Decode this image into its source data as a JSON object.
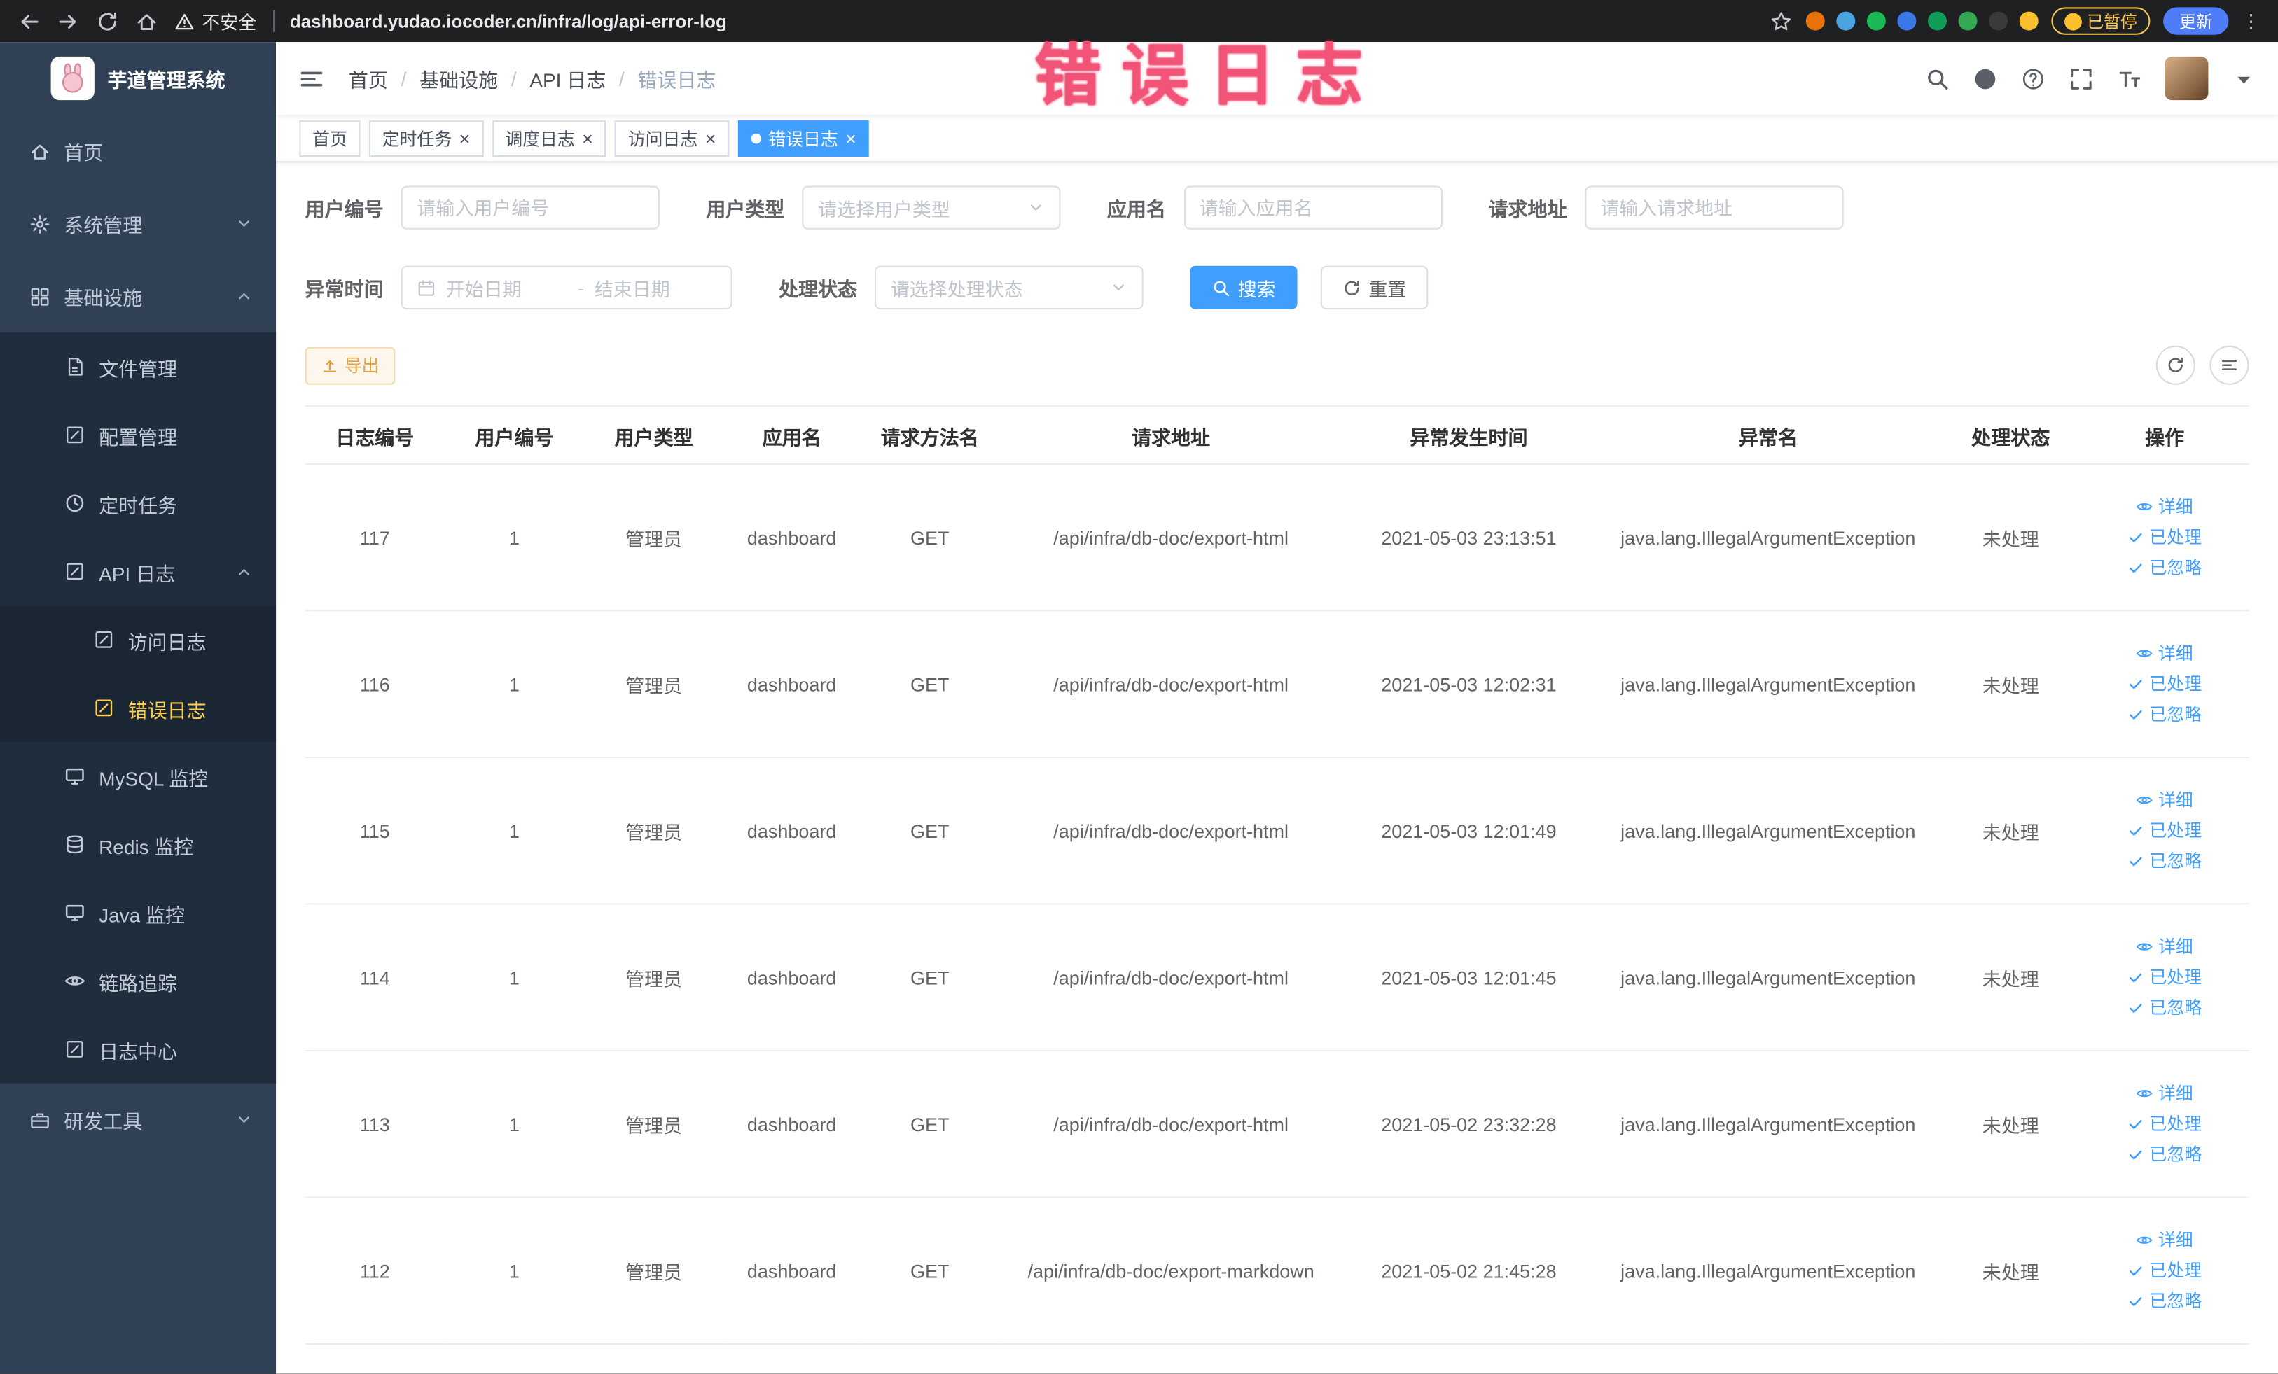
{
  "watermark": "错误日志",
  "colors": {
    "accent": "#409eff",
    "sidebar_active": "#ffd04b",
    "warning": "#e6a23c",
    "watermark_pink": "#f25477",
    "sidebar_bg": "#304156",
    "submenu_bg": "#1f2d3d"
  },
  "browser": {
    "security_label": "不安全",
    "url": "dashboard.yudao.iocoder.cn/infra/log/api-error-log",
    "paused_badge": "已暂停",
    "update_button": "更新",
    "extensions": [
      {
        "name": "extension-orange-icon",
        "color": "#e8710a"
      },
      {
        "name": "extension-blue-drop-icon",
        "color": "#4aa3df"
      },
      {
        "name": "extension-green-circle-icon",
        "color": "#1db954"
      },
      {
        "name": "extension-metro-grid-icon",
        "color": "#3b78e7"
      },
      {
        "name": "extension-on-badge-icon",
        "color": "#0f9d58"
      },
      {
        "name": "extension-leaf-icon",
        "color": "#34a853"
      },
      {
        "name": "extension-paw-icon",
        "color": "#3a3a3a"
      },
      {
        "name": "extension-smiley-icon",
        "color": "#fbc02d"
      }
    ]
  },
  "sidebar": {
    "logo_title": "芋道管理系统",
    "items": [
      {
        "name": "home",
        "label": "首页",
        "icon": "home-icon",
        "level": 1
      },
      {
        "name": "system-mgmt",
        "label": "系统管理",
        "icon": "gear-icon",
        "level": 1,
        "arrow": "down"
      },
      {
        "name": "infrastructure",
        "label": "基础设施",
        "icon": "grid-icon",
        "level": 1,
        "arrow": "up"
      },
      {
        "name": "file-mgmt",
        "label": "文件管理",
        "icon": "doc-icon",
        "level": 2
      },
      {
        "name": "config-mgmt",
        "label": "配置管理",
        "icon": "edit-icon",
        "level": 2
      },
      {
        "name": "scheduled-jobs",
        "label": "定时任务",
        "icon": "clock-icon",
        "level": 2
      },
      {
        "name": "api-logs",
        "label": "API 日志",
        "icon": "edit-icon",
        "level": 2,
        "arrow": "up"
      },
      {
        "name": "access-log",
        "label": "访问日志",
        "icon": "edit-icon",
        "level": 3
      },
      {
        "name": "error-log",
        "label": "错误日志",
        "icon": "edit-icon",
        "level": 3,
        "active": true
      },
      {
        "name": "mysql-monitor",
        "label": "MySQL 监控",
        "icon": "monitor-icon",
        "level": 2
      },
      {
        "name": "redis-monitor",
        "label": "Redis 监控",
        "icon": "db-icon",
        "level": 2
      },
      {
        "name": "java-monitor",
        "label": "Java 监控",
        "icon": "monitor-icon",
        "level": 2
      },
      {
        "name": "link-tracing",
        "label": "链路追踪",
        "icon": "eye-icon",
        "level": 2
      },
      {
        "name": "log-center",
        "label": "日志中心",
        "icon": "edit-icon",
        "level": 2
      },
      {
        "name": "dev-tools",
        "label": "研发工具",
        "icon": "toolbox-icon",
        "level": 1,
        "arrow": "down"
      }
    ]
  },
  "header": {
    "breadcrumb": [
      "首页",
      "基础设施",
      "API 日志",
      "错误日志"
    ]
  },
  "tabs": [
    {
      "name": "home",
      "label": "首页",
      "closable": false,
      "active": false
    },
    {
      "name": "scheduled-jobs",
      "label": "定时任务",
      "closable": true,
      "active": false
    },
    {
      "name": "dispatch-log",
      "label": "调度日志",
      "closable": true,
      "active": false
    },
    {
      "name": "access-log",
      "label": "访问日志",
      "closable": true,
      "active": false
    },
    {
      "name": "error-log",
      "label": "错误日志",
      "closable": true,
      "active": true
    }
  ],
  "filters": {
    "user_id": {
      "label": "用户编号",
      "placeholder": "请输入用户编号"
    },
    "user_type": {
      "label": "用户类型",
      "placeholder": "请选择用户类型"
    },
    "app_name": {
      "label": "应用名",
      "placeholder": "请输入应用名"
    },
    "request_url": {
      "label": "请求地址",
      "placeholder": "请输入请求地址"
    },
    "exception_time": {
      "label": "异常时间",
      "start_placeholder": "开始日期",
      "separator": "-",
      "end_placeholder": "结束日期"
    },
    "process_status": {
      "label": "处理状态",
      "placeholder": "请选择处理状态"
    },
    "search_button": "搜索",
    "reset_button": "重置"
  },
  "toolbar": {
    "export_button": "导出"
  },
  "table": {
    "headers": [
      "日志编号",
      "用户编号",
      "用户类型",
      "应用名",
      "请求方法名",
      "请求地址",
      "异常发生时间",
      "异常名",
      "处理状态",
      "操作"
    ],
    "actions": [
      "详细",
      "已处理",
      "已忽略"
    ],
    "rows": [
      {
        "id": "117",
        "user_id": "1",
        "user_type": "管理员",
        "app": "dashboard",
        "method": "GET",
        "url": "/api/infra/db-doc/export-html",
        "time": "2021-05-03 23:13:51",
        "exception": "java.lang.IllegalArgumentException",
        "status": "未处理"
      },
      {
        "id": "116",
        "user_id": "1",
        "user_type": "管理员",
        "app": "dashboard",
        "method": "GET",
        "url": "/api/infra/db-doc/export-html",
        "time": "2021-05-03 12:02:31",
        "exception": "java.lang.IllegalArgumentException",
        "status": "未处理"
      },
      {
        "id": "115",
        "user_id": "1",
        "user_type": "管理员",
        "app": "dashboard",
        "method": "GET",
        "url": "/api/infra/db-doc/export-html",
        "time": "2021-05-03 12:01:49",
        "exception": "java.lang.IllegalArgumentException",
        "status": "未处理"
      },
      {
        "id": "114",
        "user_id": "1",
        "user_type": "管理员",
        "app": "dashboard",
        "method": "GET",
        "url": "/api/infra/db-doc/export-html",
        "time": "2021-05-03 12:01:45",
        "exception": "java.lang.IllegalArgumentException",
        "status": "未处理"
      },
      {
        "id": "113",
        "user_id": "1",
        "user_type": "管理员",
        "app": "dashboard",
        "method": "GET",
        "url": "/api/infra/db-doc/export-html",
        "time": "2021-05-02 23:32:28",
        "exception": "java.lang.IllegalArgumentException",
        "status": "未处理"
      },
      {
        "id": "112",
        "user_id": "1",
        "user_type": "管理员",
        "app": "dashboard",
        "method": "GET",
        "url": "/api/infra/db-doc/export-markdown",
        "time": "2021-05-02 21:45:28",
        "exception": "java.lang.IllegalArgumentException",
        "status": "未处理"
      }
    ]
  }
}
